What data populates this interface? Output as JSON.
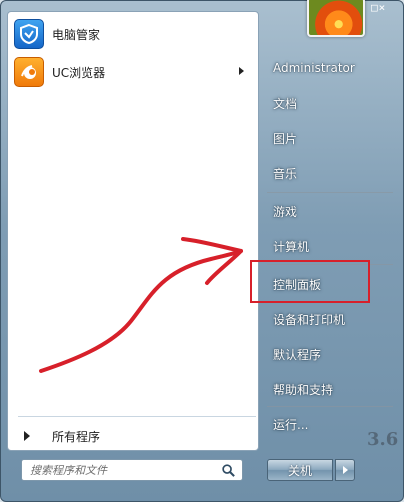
{
  "left_pane": {
    "pinned": [
      {
        "label": "电脑管家",
        "icon": "tencent-pc-manager-icon",
        "has_submenu": false
      },
      {
        "label": "UC浏览器",
        "icon": "uc-browser-icon",
        "has_submenu": true
      }
    ],
    "all_programs_label": "所有程序"
  },
  "search": {
    "placeholder": "搜索程序和文件",
    "value": "",
    "icon": "magnifier-icon"
  },
  "right_pane": {
    "user_name": "Administrator",
    "items": [
      {
        "label": "文档"
      },
      {
        "label": "图片"
      },
      {
        "label": "音乐"
      },
      {
        "label": "游戏"
      },
      {
        "label": "计算机"
      },
      {
        "label": "控制面板"
      },
      {
        "label": "设备和打印机"
      },
      {
        "label": "默认程序"
      },
      {
        "label": "帮助和支持"
      },
      {
        "label": "运行..."
      }
    ],
    "top_glyph": "□×"
  },
  "shutdown": {
    "label": "关机",
    "options_icon": "triangle-right-icon"
  },
  "watermark": "3.6",
  "annotation": {
    "highlight_color": "#d7202a",
    "highlighted_item": "控制面板"
  }
}
